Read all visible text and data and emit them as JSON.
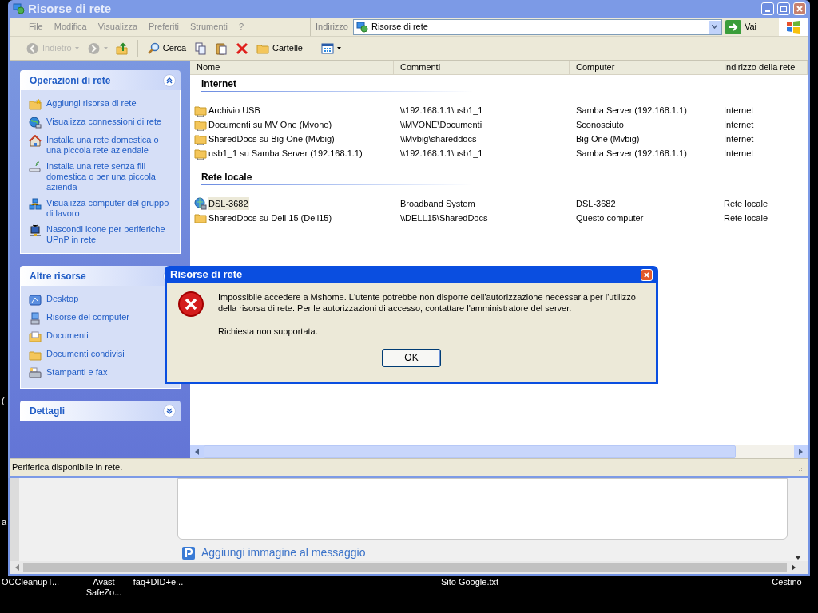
{
  "explorer": {
    "title": "Risorse di rete",
    "menu": [
      "File",
      "Modifica",
      "Visualizza",
      "Preferiti",
      "Strumenti",
      "?"
    ],
    "address": {
      "label": "Indirizzo",
      "value": "Risorse di rete",
      "go": "Vai"
    },
    "toolbar": [
      {
        "kind": "back",
        "label": "Indietro",
        "disabled": true
      },
      {
        "kind": "forward",
        "disabled": true
      },
      {
        "kind": "up",
        "disabled": false
      },
      {
        "kind": "search",
        "label": "Cerca",
        "disabled": false
      },
      {
        "kind": "copy",
        "disabled": false
      },
      {
        "kind": "paste",
        "disabled": false
      },
      {
        "kind": "delete",
        "disabled": false
      },
      {
        "kind": "folders",
        "label": "Cartelle",
        "disabled": false
      },
      {
        "kind": "views",
        "disabled": false
      }
    ],
    "task_panels": [
      {
        "title": "Operazioni di rete",
        "expanded": true,
        "items": [
          {
            "kind": "add_place",
            "label": "Aggiungi risorsa di rete"
          },
          {
            "kind": "connections",
            "label": "Visualizza connessioni di rete"
          },
          {
            "kind": "home_network",
            "label": "Installa una rete domestica o una piccola rete aziendale"
          },
          {
            "kind": "wireless",
            "label": "Installa una rete senza fili domestica o per una piccola azienda"
          },
          {
            "kind": "workgroup",
            "label": "Visualizza computer del gruppo di lavoro"
          },
          {
            "kind": "upnp",
            "label": "Nascondi icone per periferiche UPnP in rete"
          }
        ]
      },
      {
        "title": "Altre risorse",
        "expanded": true,
        "items": [
          {
            "kind": "desktop",
            "label": "Desktop"
          },
          {
            "kind": "my_computer",
            "label": "Risorse del computer"
          },
          {
            "kind": "documents",
            "label": "Documenti"
          },
          {
            "kind": "shared_documents",
            "label": "Documenti condivisi"
          },
          {
            "kind": "printers",
            "label": "Stampanti e fax"
          }
        ]
      },
      {
        "title": "Dettagli",
        "expanded": false
      }
    ],
    "columns": [
      "Nome",
      "Commenti",
      "Computer",
      "Indirizzo della rete"
    ],
    "groups": [
      {
        "title": "Internet",
        "rows": [
          {
            "kind": "share",
            "selected": false,
            "cells": [
              "Archivio USB",
              "\\\\192.168.1.1\\usb1_1",
              "Samba Server (192.168.1.1)",
              "Internet"
            ]
          },
          {
            "kind": "share",
            "selected": false,
            "cells": [
              "Documenti su MV One (Mvone)",
              "\\\\MVONE\\Documenti",
              "Sconosciuto",
              "Internet"
            ]
          },
          {
            "kind": "share",
            "selected": false,
            "cells": [
              "SharedDocs su Big One (Mvbig)",
              "\\\\Mvbig\\shareddocs",
              "Big One (Mvbig)",
              "Internet"
            ]
          },
          {
            "kind": "share",
            "selected": false,
            "cells": [
              "usb1_1 su Samba Server (192.168.1.1)",
              "\\\\192.168.1.1\\usb1_1",
              "Samba Server (192.168.1.1)",
              "Internet"
            ]
          }
        ]
      },
      {
        "title": "Rete locale",
        "rows": [
          {
            "kind": "device",
            "selected": true,
            "cells": [
              "DSL-3682",
              "Broadband System",
              "DSL-3682",
              "Rete locale"
            ]
          },
          {
            "kind": "folder",
            "selected": false,
            "cells": [
              "SharedDocs su Dell 15 (Dell15)",
              "\\\\DELL15\\SharedDocs",
              "Questo computer",
              "Rete locale"
            ]
          }
        ]
      }
    ],
    "status": "Periferica disponibile in rete."
  },
  "dialog": {
    "title": "Risorse di rete",
    "message": "Impossibile accedere a Mshome. L'utente potrebbe non disporre dell'autorizzazione necessaria per l'utilizzo della risorsa di rete. Per le autorizzazioni di accesso, contattare l'amministratore del server.",
    "detail": "Richiesta non supportata.",
    "button": "OK"
  },
  "browser": {
    "link": "Aggiungi immagine al messaggio"
  },
  "desktop_edge_texts": [
    "(",
    "a"
  ],
  "desktop_icons": [
    "OCCleanupT...",
    "Avast SafeZo...",
    "faq+DID+e...",
    "Sito Google.txt",
    "Cestino"
  ]
}
